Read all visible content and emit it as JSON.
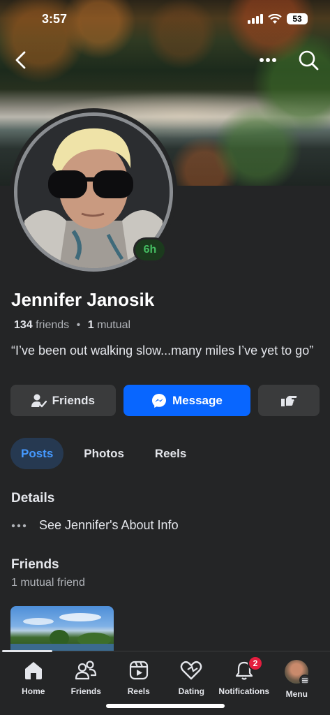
{
  "status_bar": {
    "time": "3:57",
    "battery": "53"
  },
  "profile": {
    "name": "Jennifer Janosik",
    "friends_count": "134",
    "friends_word": "friends",
    "separator": "•",
    "mutual_count": "1",
    "mutual_word": "mutual",
    "bio": "“I’ve been out walking slow...many miles I’ve yet to go”",
    "story_age": "6h"
  },
  "actions": {
    "friends_label": "Friends",
    "message_label": "Message"
  },
  "tabs": [
    {
      "label": "Posts",
      "active": true
    },
    {
      "label": "Photos",
      "active": false
    },
    {
      "label": "Reels",
      "active": false
    }
  ],
  "details": {
    "title": "Details",
    "about_link": "See Jennifer's About Info"
  },
  "friends_section": {
    "title": "Friends",
    "subtitle": "1 mutual friend"
  },
  "bottom_nav": {
    "items": [
      {
        "label": "Home",
        "icon": "home-icon",
        "active": true
      },
      {
        "label": "Friends",
        "icon": "friends-icon"
      },
      {
        "label": "Reels",
        "icon": "reels-icon"
      },
      {
        "label": "Dating",
        "icon": "dating-heart-icon"
      },
      {
        "label": "Notifications",
        "icon": "bell-icon",
        "badge": "2"
      },
      {
        "label": "Menu",
        "icon": "profile-avatar"
      }
    ]
  },
  "colors": {
    "accent": "#0866ff",
    "story_green": "#45bd62",
    "badge_red": "#e41e3f",
    "active_tab_bg": "#263951"
  }
}
